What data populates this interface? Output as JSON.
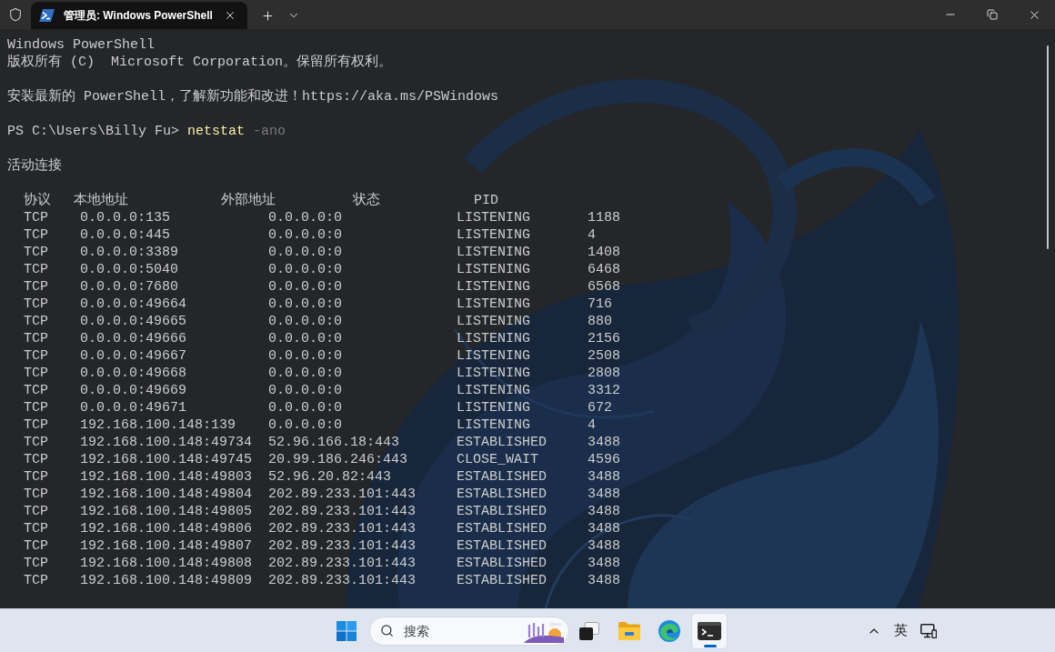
{
  "title_bar": {
    "tabs": [
      {
        "title": "管理员: Windows PowerShell",
        "selected": true
      }
    ]
  },
  "terminal": {
    "banner": [
      "Windows PowerShell",
      "版权所有 (C)  Microsoft Corporation。保留所有权利。"
    ],
    "notice": "安装最新的 PowerShell，了解新功能和改进！https://aka.ms/PSWindows",
    "prompt": {
      "path": "PS C:\\Users\\Billy Fu>",
      "command": "netstat",
      "arguments": "-ano"
    },
    "section_title": "活动连接",
    "header_labels": [
      "协议",
      "本地地址",
      "外部地址",
      "状态",
      "PID"
    ],
    "table": {
      "rows": [
        [
          "TCP",
          "0.0.0.0:135",
          "0.0.0.0:0",
          "LISTENING",
          "1188"
        ],
        [
          "TCP",
          "0.0.0.0:445",
          "0.0.0.0:0",
          "LISTENING",
          "4"
        ],
        [
          "TCP",
          "0.0.0.0:3389",
          "0.0.0.0:0",
          "LISTENING",
          "1408"
        ],
        [
          "TCP",
          "0.0.0.0:5040",
          "0.0.0.0:0",
          "LISTENING",
          "6468"
        ],
        [
          "TCP",
          "0.0.0.0:7680",
          "0.0.0.0:0",
          "LISTENING",
          "6568"
        ],
        [
          "TCP",
          "0.0.0.0:49664",
          "0.0.0.0:0",
          "LISTENING",
          "716"
        ],
        [
          "TCP",
          "0.0.0.0:49665",
          "0.0.0.0:0",
          "LISTENING",
          "880"
        ],
        [
          "TCP",
          "0.0.0.0:49666",
          "0.0.0.0:0",
          "LISTENING",
          "2156"
        ],
        [
          "TCP",
          "0.0.0.0:49667",
          "0.0.0.0:0",
          "LISTENING",
          "2508"
        ],
        [
          "TCP",
          "0.0.0.0:49668",
          "0.0.0.0:0",
          "LISTENING",
          "2808"
        ],
        [
          "TCP",
          "0.0.0.0:49669",
          "0.0.0.0:0",
          "LISTENING",
          "3312"
        ],
        [
          "TCP",
          "0.0.0.0:49671",
          "0.0.0.0:0",
          "LISTENING",
          "672"
        ],
        [
          "TCP",
          "192.168.100.148:139",
          "0.0.0.0:0",
          "LISTENING",
          "4"
        ],
        [
          "TCP",
          "192.168.100.148:49734",
          "52.96.166.18:443",
          "ESTABLISHED",
          "3488"
        ],
        [
          "TCP",
          "192.168.100.148:49745",
          "20.99.186.246:443",
          "CLOSE_WAIT",
          "4596"
        ],
        [
          "TCP",
          "192.168.100.148:49803",
          "52.96.20.82:443",
          "ESTABLISHED",
          "3488"
        ],
        [
          "TCP",
          "192.168.100.148:49804",
          "202.89.233.101:443",
          "ESTABLISHED",
          "3488"
        ],
        [
          "TCP",
          "192.168.100.148:49805",
          "202.89.233.101:443",
          "ESTABLISHED",
          "3488"
        ],
        [
          "TCP",
          "192.168.100.148:49806",
          "202.89.233.101:443",
          "ESTABLISHED",
          "3488"
        ],
        [
          "TCP",
          "192.168.100.148:49807",
          "202.89.233.101:443",
          "ESTABLISHED",
          "3488"
        ],
        [
          "TCP",
          "192.168.100.148:49808",
          "202.89.233.101:443",
          "ESTABLISHED",
          "3488"
        ],
        [
          "TCP",
          "192.168.100.148:49809",
          "202.89.233.101:443",
          "ESTABLISHED",
          "3488"
        ]
      ]
    }
  },
  "taskbar": {
    "search": {
      "placeholder": "搜索"
    },
    "apps": [
      {
        "kind": "start",
        "selected": false
      },
      {
        "kind": "task_view",
        "selected": false
      },
      {
        "kind": "files",
        "selected": false
      },
      {
        "kind": "browser",
        "selected": false
      },
      {
        "kind": "terminal",
        "selected": true
      }
    ],
    "tray": {
      "input_method": "英"
    }
  }
}
